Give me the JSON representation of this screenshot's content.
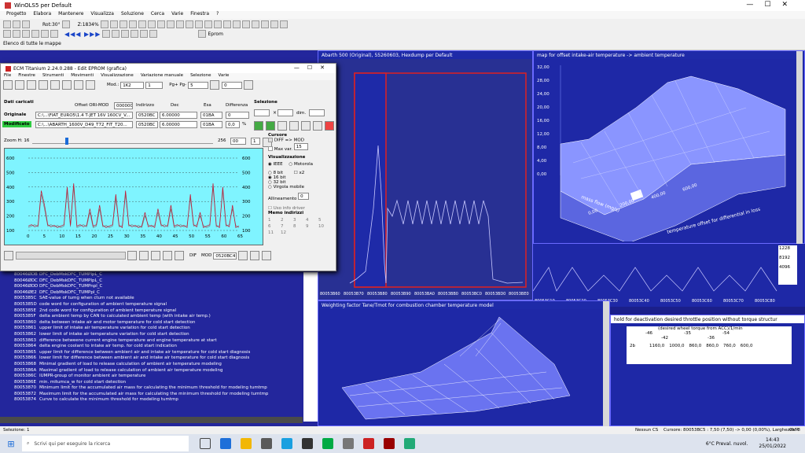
{
  "app": {
    "title": "WinOLS5 per Default",
    "status": "Selezione: 1"
  },
  "menu": [
    "Progetto",
    "Elabora",
    "Mantenere",
    "Visualizza",
    "Soluzione",
    "Cerca",
    "Varie",
    "Finestra",
    "?"
  ],
  "toolbar": {
    "rot": "Rot:30°",
    "zoom": "Z:1834%",
    "eprom": "Eprom",
    "group_label": "Elenco di tutte le mappe"
  },
  "ecm": {
    "title": "ECM Titanium 2.24.0.288 - Edit EPROM (grafica)",
    "menu": [
      "File",
      "Finestre",
      "Strumenti",
      "Movimenti",
      "Visualizzazione",
      "Variazione manuale",
      "Selezione",
      "Varie"
    ],
    "mod_label": "Mod.:",
    "mod_value": "1K2",
    "mod_step": "1",
    "pg_label": "Pg+ Pg-",
    "pg_value": "5",
    "val_zero": "0",
    "dati_caricati": "Dati caricati",
    "offset_label": "Offset ORI-MOD",
    "offset_value": "000000",
    "indirizzo": "Indirizzo",
    "dec": "Dec",
    "esa": "Esa",
    "differenza": "Differenza",
    "selezione": "Selezione",
    "originale": "Originale",
    "modificato": "Modificato",
    "ori_path": "C:\\...\\FIAT_EURO5\\1.4 T-JET 16V 160CV_V... ",
    "mod_path": "C:\\...\\ABARTH_1600V_D49_T72_FIT_T20...",
    "ori_addr": "0520BC",
    "mod_addr": "0520BC",
    "ori_dec": "6.00000",
    "mod_dec": "6.00000",
    "ori_esa": "01BA",
    "mod_esa": "01BA",
    "ori_diff": "0",
    "mod_diff": "0,0",
    "mod_pct": "%",
    "dim_label": "dim.",
    "zoom_label": "Zoom H: 16",
    "zoom_num": "256",
    "zoom_num2": "00",
    "zoom_step": "1",
    "cursore": "Cursore",
    "diff_mod": "DIFF => MOD",
    "max_var": "Max var.",
    "max_var_val": "15",
    "visualizzazione": "Visualizzazione",
    "ieee": "IEEE",
    "motorola": "Motorola",
    "bit8": "8 bit",
    "x2": "x2",
    "bit16": "16 bit",
    "bit32": "32 bit",
    "virgola": "Virgola mobile",
    "allineamento": "Allineamento",
    "align_val": "0",
    "uso_info": "Uso info driver",
    "memo": "Memo indirizzi",
    "memo_nums": [
      "1",
      "2",
      "3",
      "4",
      "5",
      "6",
      "7",
      "8",
      "9",
      "10",
      "11",
      "12"
    ],
    "x_ticks": [
      "0",
      "5",
      "10",
      "15",
      "20",
      "25",
      "30",
      "35",
      "40",
      "45",
      "50",
      "55",
      "60",
      "65"
    ],
    "y_left": [
      "600",
      "500",
      "400",
      "300",
      "200",
      "100"
    ],
    "y_right": [
      "600",
      "500",
      "400",
      "300",
      "200",
      "100"
    ],
    "btn_dif": "DIF",
    "btn_mod": "MOD",
    "bottom_addr": "0520BC4",
    "colors": {
      "graph_bg": "#7ff4ff",
      "line_ori": "#7a7a7a",
      "line_mod": "#c8102e"
    }
  },
  "list": {
    "rows": [
      [
        "80046ØDB",
        "DFC_DebMskDFC_TUMPIpL_C"
      ],
      [
        "80046ØDC",
        "DFC_DebMskDFC_TUMPIpL_C"
      ],
      [
        "80046ØDD",
        "DFC_DebMskDFC_TUMPnpl_C"
      ],
      [
        "80046ØE2",
        "DFC_DebMskDFC_TUMPpl_C"
      ],
      [
        "8005385C",
        "SAE-value of tumg when ctum not available"
      ],
      [
        "8005385D",
        "code word for configuration of ambient temperature signal"
      ],
      [
        "8005385E",
        "2nd code word for configuration of ambient temperature signal"
      ],
      [
        "8005385F",
        "delta ambient temp by CAN to calculated ambient temp (with intake air temp.)"
      ],
      [
        "80053860",
        "delta between intake air and motor temperature for cold start detection"
      ],
      [
        "80053861",
        "upper limit of intake air temperature variation for cold start detection"
      ],
      [
        "80053862",
        "lower limit of intake air temperature variation for cold start detection"
      ],
      [
        "80053863",
        "difference betweene current engine temperature and engine temperature at start"
      ],
      [
        "80053864",
        "delta engine coolant to intake air temp. for cold start indication"
      ],
      [
        "80053865",
        "upper limit for difference between ambient air and intake air temperature for cold start diagnosis"
      ],
      [
        "80053866",
        "lower limit for difference between ambient air and intake air temperature for cold start diagnosis"
      ],
      [
        "80053868",
        "Minimal gradient of load to release calculation of ambient air temperature modeling"
      ],
      [
        "8005386A",
        "Maximal gradient of load to release calculation of ambient air temperature modeling"
      ],
      [
        "8005386C",
        "IUMPR-group of monitor ambient air temperature"
      ],
      [
        "8005386E",
        "min. mitumca_w for cold start detection"
      ],
      [
        "80053870",
        "Minimum limit for the accumulated air mass for calculating the minimum threshold for modeling tumtmp"
      ],
      [
        "80053872",
        "Maximum limit for the accumulated air mass for calculating the minimum threshold for modeling tumtmp"
      ],
      [
        "80053874",
        "Curve to calculate the minimum threshold for modeling tumtmp"
      ]
    ]
  },
  "hexdump": {
    "title": "Abarth 500 (Original), 55260603, Hexdump per Default",
    "x_labels": [
      "80053B60",
      "80053B70",
      "80053B80",
      "80053B90",
      "80053BA0",
      "80053BB0",
      "80053BC0",
      "80053BD0",
      "80053BE0"
    ]
  },
  "map3d_top": {
    "title": "map for offset intake-air temperature -> ambient temperature",
    "z_ticks": [
      "32,00",
      "28,00",
      "24,00",
      "20,00",
      "16,00",
      "12,00",
      "8,00",
      "4,00",
      "0,00"
    ],
    "x_ticks": [
      "0,00",
      "200,00",
      "400,00",
      "600,00"
    ],
    "axis_label_a": "mass flow (mg/s)",
    "axis_label_b": "temperature offset for differential in loss"
  },
  "hex_strip": {
    "values": [
      "1228",
      "8192",
      "4096"
    ],
    "x_labels": [
      "80053C10",
      "80053C20",
      "80053C30",
      "80053C40",
      "80053C50",
      "80053C60",
      "80053C70",
      "80053C80"
    ]
  },
  "map3d_bottom": {
    "title": "Weighting factor Tane/Tmot for combustion chamber temperature model"
  },
  "table": {
    "title": "hold for deactivation desired throttle position without torque structur",
    "subtitle": "(desired wheel torque from ACC)/1/min",
    "header1": [
      "-46",
      "-35",
      "-54"
    ],
    "header2": [
      "-42",
      "-36"
    ],
    "row_label": "2b",
    "values": [
      "1160,0",
      "1000,0",
      "860,0",
      "860,0",
      "760,0",
      "600,0"
    ]
  },
  "status": {
    "nessun": "Nessun CS",
    "cursor": "Cursore: 80053BC5 : 7,50 (7,50) -> 0,00 (0,00%), Larghezza: 8",
    "ovr": "OVR"
  },
  "taskbar": {
    "search": "Scrivi qui per eseguire la ricerca",
    "weather": "6°C Preval. nuvol.",
    "time": "14:43",
    "date": "25/01/2022"
  }
}
